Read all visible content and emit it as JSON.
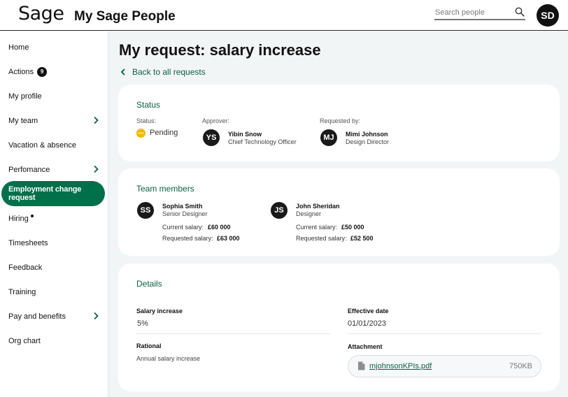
{
  "header": {
    "logo": "Sage",
    "app_title": "My Sage People",
    "search_placeholder": "Search people",
    "user_initials": "SD"
  },
  "sidebar": {
    "items": [
      {
        "label": "Home"
      },
      {
        "label": "Actions",
        "badge": "9"
      },
      {
        "label": "My profile"
      },
      {
        "label": "My team"
      },
      {
        "label": "Vacation & absence"
      },
      {
        "label": "Perfomance"
      },
      {
        "label": "Employment change request"
      },
      {
        "label": "Hiring"
      },
      {
        "label": "Timesheets"
      },
      {
        "label": "Feedback"
      },
      {
        "label": "Training"
      },
      {
        "label": "Pay and benefits"
      },
      {
        "label": "Org chart"
      }
    ]
  },
  "main": {
    "title": "My request: salary increase",
    "back_link": "Back to all requests",
    "status_card": {
      "title": "Status",
      "status_label": "Status:",
      "status_value": "Pending",
      "approver_label": "Approver:",
      "approver": {
        "initials": "YS",
        "name": "Yibin Snow",
        "role": "Chief Technology Officer"
      },
      "requested_by_label": "Requested by:",
      "requester": {
        "initials": "MJ",
        "name": "Mimi Johnson",
        "role": "Design Director"
      }
    },
    "team_card": {
      "title": "Team members",
      "members": [
        {
          "initials": "SS",
          "name": "Sophia Smith",
          "role": "Senior Designer",
          "current_label": "Current salary:",
          "current": "£60 000",
          "requested_label": "Requested salary:",
          "requested": "£63 000"
        },
        {
          "initials": "JS",
          "name": "John Sheridan",
          "role": "Designer",
          "current_label": "Current salary:",
          "current": "£50 000",
          "requested_label": "Requested salary:",
          "requested": "£52 500"
        }
      ]
    },
    "details_card": {
      "title": "Details",
      "salary_increase_label": "Salary increase",
      "salary_increase_value": "5%",
      "effective_date_label": "Effective date",
      "effective_date_value": "01/01/2023",
      "rational_label": "Rational",
      "rational_value": "Annual salary increase",
      "attachment_label": "Attachment",
      "attachment_name": "mjohnsonKPIs.pdf",
      "attachment_size": "750KB"
    }
  },
  "colors": {
    "accent_green": "#00704a",
    "link_green": "#0b5e40",
    "pending_amber": "#f5b800",
    "page_bg": "#f2f5f6"
  }
}
